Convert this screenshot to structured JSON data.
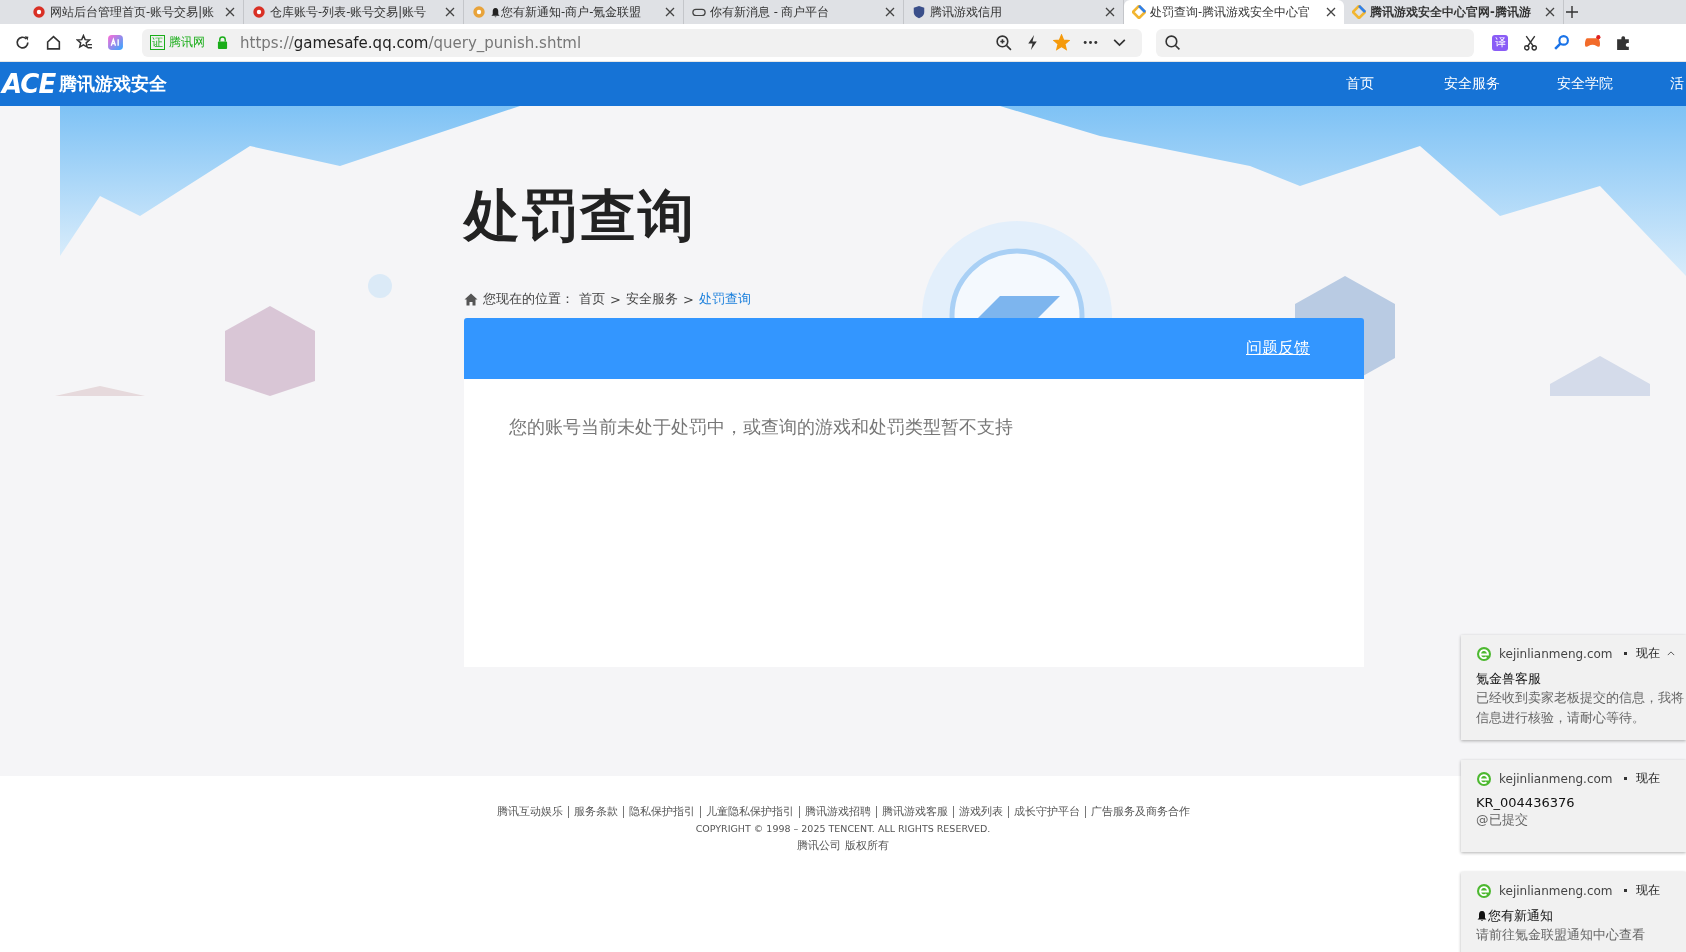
{
  "tabs": [
    {
      "title": "网站后台管理首页-账号交易|账",
      "selected": false,
      "bold": false,
      "kind": "red",
      "bell": false
    },
    {
      "title": "仓库账号-列表-账号交易|账号",
      "selected": false,
      "bold": false,
      "kind": "red",
      "bell": false
    },
    {
      "title": "您有新通知-商户-氪金联盟",
      "selected": false,
      "bold": false,
      "kind": "game",
      "bell": true
    },
    {
      "title": "你有新消息 - 商户平台",
      "selected": false,
      "bold": false,
      "kind": "pad",
      "bell": false
    },
    {
      "title": "腾讯游戏信用",
      "selected": false,
      "bold": false,
      "kind": "shield",
      "bell": false
    },
    {
      "title": "处罚查询-腾讯游戏安全中心官",
      "selected": true,
      "bold": false,
      "kind": "diamond",
      "bell": false
    },
    {
      "title": "腾讯游戏安全中心官网-腾讯游",
      "selected": false,
      "bold": true,
      "kind": "diamond",
      "bell": false
    }
  ],
  "address_bar": {
    "cert": "证",
    "cert_label": "腾讯网",
    "url": {
      "scheme": "https://",
      "domain": "gamesafe.qq.com",
      "path": "/query_punish.shtml"
    },
    "bookmarked": true
  },
  "extensions": [
    {
      "kind": "translate",
      "text": "译"
    },
    {
      "kind": "scissors"
    },
    {
      "kind": "key"
    },
    {
      "kind": "game"
    },
    {
      "kind": "puzzle"
    }
  ],
  "site": {
    "logo_mark": "ACE",
    "logo_text": "腾讯游戏安全",
    "nav": [
      {
        "label": "首页"
      },
      {
        "label": "安全服务"
      },
      {
        "label": "安全学院"
      },
      {
        "label": "活"
      }
    ]
  },
  "page": {
    "title": "处罚查询",
    "breadcrumb": {
      "label": "您现在的位置：",
      "items": [
        {
          "kind": "link",
          "text": "首页",
          "current": false
        },
        {
          "kind": "sep",
          "text": ">"
        },
        {
          "kind": "link",
          "text": "安全服务",
          "current": false
        },
        {
          "kind": "sep",
          "text": ">"
        },
        {
          "kind": "link",
          "text": "处罚查询",
          "current": true
        }
      ]
    },
    "panel": {
      "feedback_link": "问题反馈",
      "message": "您的账号当前未处于处罚中，或查询的游戏和处罚类型暂不支持"
    }
  },
  "footer": {
    "links": [
      "腾讯互动娱乐",
      "服务条款",
      "隐私保护指引",
      "儿童隐私保护指引",
      "腾讯游戏招聘",
      "腾讯游戏客服",
      "游戏列表",
      "成长守护平台",
      "广告服务及商务合作"
    ],
    "copyright": "COPYRIGHT © 1998 – 2025 TENCENT. ALL RIGHTS RESERVED.",
    "rights": "腾讯公司 版权所有"
  },
  "notifications": [
    {
      "site": "kejinlianmeng.com",
      "time": "现在",
      "expanded": true,
      "bell": false,
      "title": "氪金兽客服",
      "body": [
        "已经收到卖家老板提交的信息，我将",
        "信息进行核验，请耐心等待。"
      ]
    },
    {
      "site": "kejinlianmeng.com",
      "time": "现在",
      "expanded": false,
      "bell": false,
      "title": "KR_004436376",
      "body": [
        "@已提交"
      ]
    },
    {
      "site": "kejinlianmeng.com",
      "time": "现在",
      "expanded": false,
      "bell": true,
      "title": "您有新通知",
      "body": [
        "请前往氪金联盟通知中心查看"
      ]
    }
  ]
}
